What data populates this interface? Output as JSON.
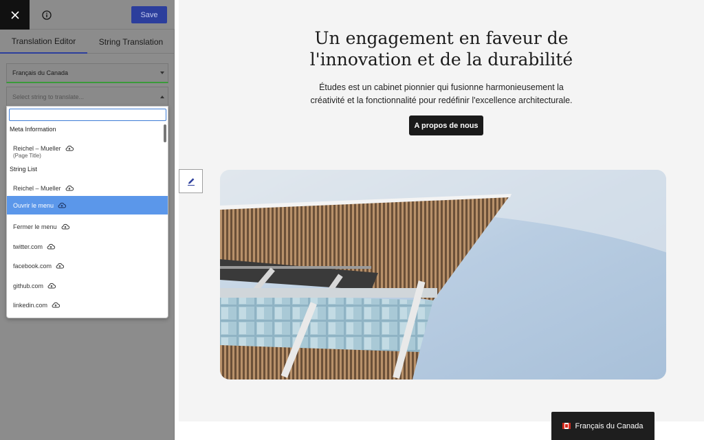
{
  "toolbar": {
    "save_label": "Save"
  },
  "tabs": [
    {
      "label": "Translation Editor",
      "active": true
    },
    {
      "label": "String Translation",
      "active": false
    }
  ],
  "language_select": {
    "value": "Français du Canada"
  },
  "string_select": {
    "placeholder": "Select string to translate..."
  },
  "dropdown": {
    "search_value": "",
    "groups": {
      "meta": "Meta Information",
      "strings": "String List"
    },
    "meta_items": [
      {
        "label": "Reichel – Mueller",
        "sub": "(Page Title)"
      }
    ],
    "string_items": [
      {
        "label": "Reichel – Mueller",
        "selected": false
      },
      {
        "label": "Ouvrir le menu",
        "selected": true
      },
      {
        "label": "Fermer le menu",
        "selected": false
      },
      {
        "label": "twitter.com",
        "selected": false
      },
      {
        "label": "facebook.com",
        "selected": false
      },
      {
        "label": "github.com",
        "selected": false
      },
      {
        "label": "linkedin.com",
        "selected": false
      }
    ],
    "item_icon": "cloud-upload-icon"
  },
  "hero": {
    "title_line1": "Un engagement en faveur de",
    "title_line2": "l'innovation et de la durabilité",
    "desc_line1": "Études est un cabinet pionnier qui fusionne harmonieusement la",
    "desc_line2": "créativité et la fonctionnalité pour redéfinir l'excellence architecturale.",
    "button_label": "A propos de nous"
  },
  "language_badge": {
    "label": "Français du Canada",
    "flag": "flag-canada-icon"
  },
  "colors": {
    "accent": "#2c3e9c",
    "selected_item": "#5b97ea",
    "sidebar_overlay": "#8c8c8c",
    "dark_button": "#1a1a1a"
  }
}
